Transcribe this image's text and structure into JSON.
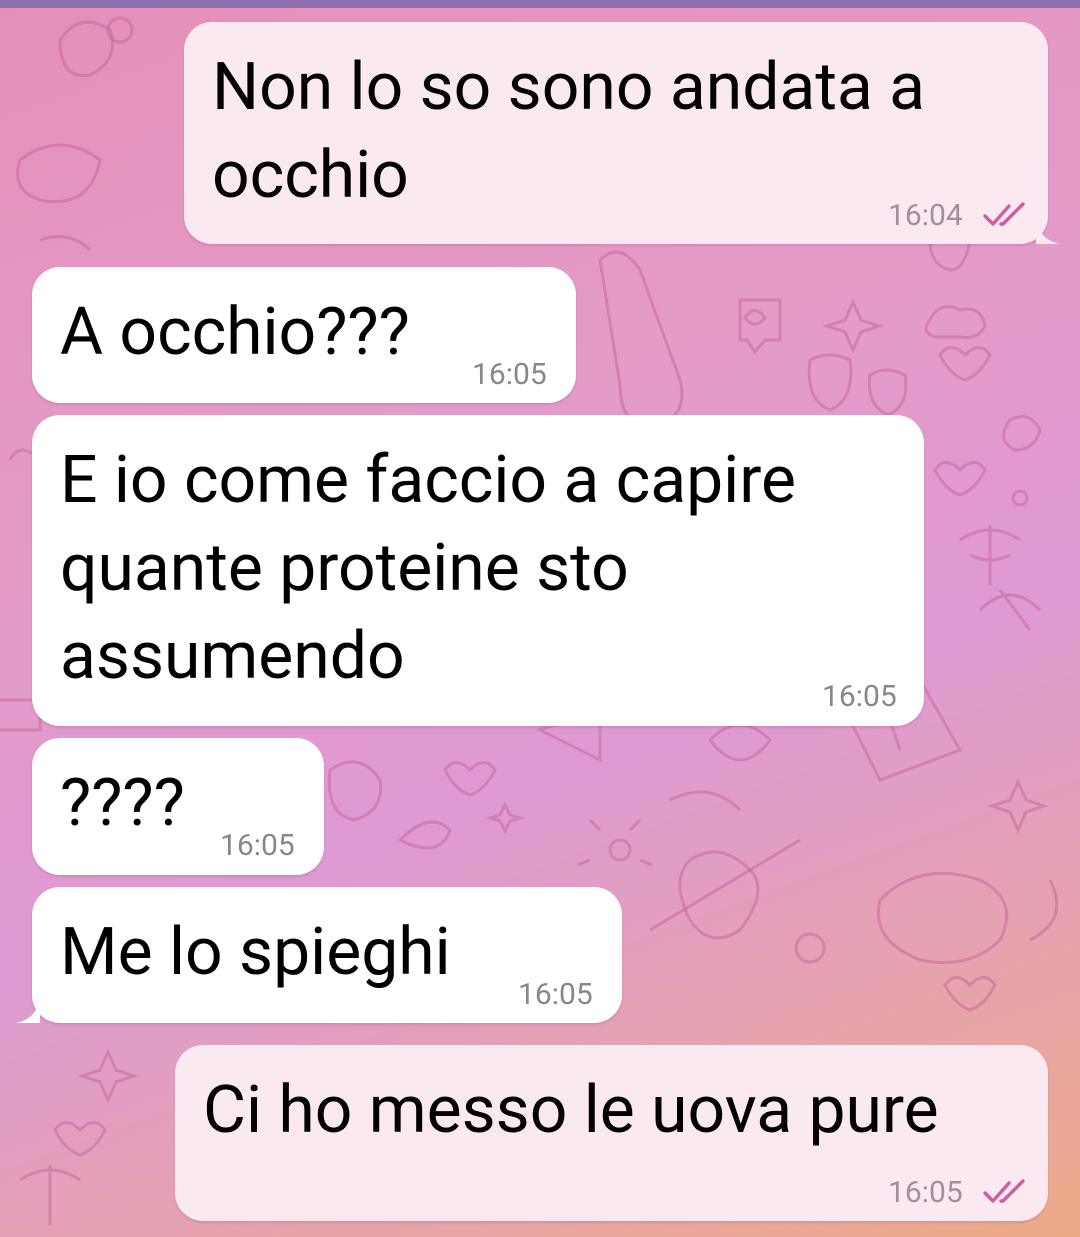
{
  "messages": [
    {
      "direction": "outgoing",
      "lines": [
        "Non lo so sono andata a",
        "occhio"
      ],
      "time": "16:04",
      "status": "read"
    },
    {
      "direction": "incoming",
      "lines": [
        "A occhio???"
      ],
      "time": "16:05"
    },
    {
      "direction": "incoming",
      "lines": [
        "E io come faccio a capire",
        "quante proteine sto",
        "assumendo"
      ],
      "time": "16:05"
    },
    {
      "direction": "incoming",
      "lines": [
        "????"
      ],
      "time": "16:05"
    },
    {
      "direction": "incoming",
      "lines": [
        "Me lo spieghi"
      ],
      "time": "16:05"
    },
    {
      "direction": "outgoing",
      "lines": [
        "Ci ho messo le uova pure"
      ],
      "time": "16:05",
      "status": "read"
    }
  ],
  "colors": {
    "incoming_bubble": "#ffffff",
    "outgoing_bubble": "#fbe9f1",
    "read_ticks": "#d15c9f"
  },
  "icons": {
    "read_status": "double-check-icon"
  }
}
